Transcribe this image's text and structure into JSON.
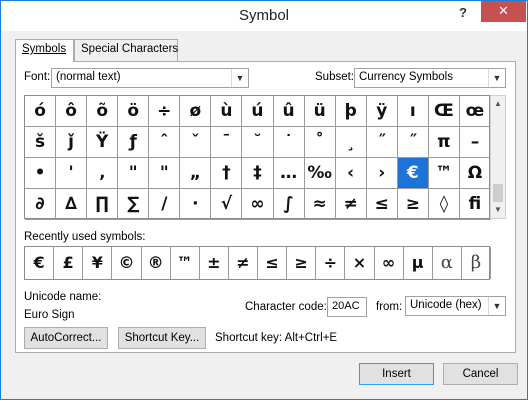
{
  "window": {
    "title": "Symbol",
    "help": "?",
    "close": "✕"
  },
  "tabs": [
    {
      "label": "Symbols"
    },
    {
      "label": "Special Characters"
    }
  ],
  "font": {
    "label": "Font:",
    "value": "(normal text)"
  },
  "subset": {
    "label": "Subset:",
    "value": "Currency Symbols"
  },
  "grid": [
    [
      "ó",
      "ô",
      "õ",
      "ö",
      "÷",
      "ø",
      "ù",
      "ú",
      "û",
      "ü",
      "þ",
      "ÿ",
      "ı",
      "Œ",
      "œ"
    ],
    [
      "š",
      "ǰ",
      "Ÿ",
      "ƒ",
      "ˆ",
      "ˇ",
      "ˉ",
      "˘",
      "˙",
      "˚",
      "˛",
      "˝",
      "˞",
      "π",
      "–"
    ],
    [
      "•",
      "•",
      "‚",
      "ˮ",
      "ˮ",
      "„",
      "†",
      "‡",
      "…",
      "‰",
      "‹",
      "›",
      "€",
      "™",
      "Ω"
    ],
    [
      "∂",
      "∆",
      "∏",
      "∑",
      "/",
      "·",
      "√",
      "∞",
      "∫",
      "≈",
      "≠",
      "≤",
      "≥",
      "◊",
      "ﬁ"
    ]
  ],
  "grid_display": [
    [
      "ó",
      "ô",
      "õ",
      "ö",
      "÷",
      "ø",
      "ù",
      "ú",
      "û",
      "ü",
      "þ",
      "ÿ",
      "ı",
      "Œ",
      "œ"
    ],
    [
      "š",
      "ǰ",
      "Ÿ",
      "ƒ",
      "ˆ",
      "ˇ",
      "ˉ",
      "˘",
      "˙",
      "˚",
      "¸",
      "˝",
      "˝",
      "π",
      "–"
    ],
    [
      "•",
      "'",
      "‚",
      "\"",
      "\"",
      "„",
      "†",
      "‡",
      "…",
      "‰",
      "‹",
      "›",
      "€",
      "™",
      "Ω"
    ],
    [
      "∂",
      "∆",
      "∏",
      "∑",
      "/",
      "·",
      "√",
      "∞",
      "∫",
      "≈",
      "≠",
      "≤",
      "≥",
      "◊",
      "ﬁ"
    ]
  ],
  "selected_symbol": "€",
  "recent": {
    "label": "Recently used symbols:",
    "items": [
      "€",
      "£",
      "¥",
      "©",
      "®",
      "™",
      "±",
      "≠",
      "≤",
      "≥",
      "÷",
      "×",
      "∞",
      "µ",
      "α",
      "β"
    ]
  },
  "unicode_name": {
    "label": "Unicode name:",
    "value": "Euro Sign"
  },
  "char_code": {
    "label": "Character code:",
    "value": "20AC"
  },
  "from": {
    "label": "from:",
    "value": "Unicode (hex)"
  },
  "buttons": {
    "autocorrect": "AutoCorrect...",
    "shortcut_key": "Shortcut Key...",
    "insert": "Insert",
    "cancel": "Cancel"
  },
  "shortcut_text": "Shortcut key: Alt+Ctrl+E"
}
